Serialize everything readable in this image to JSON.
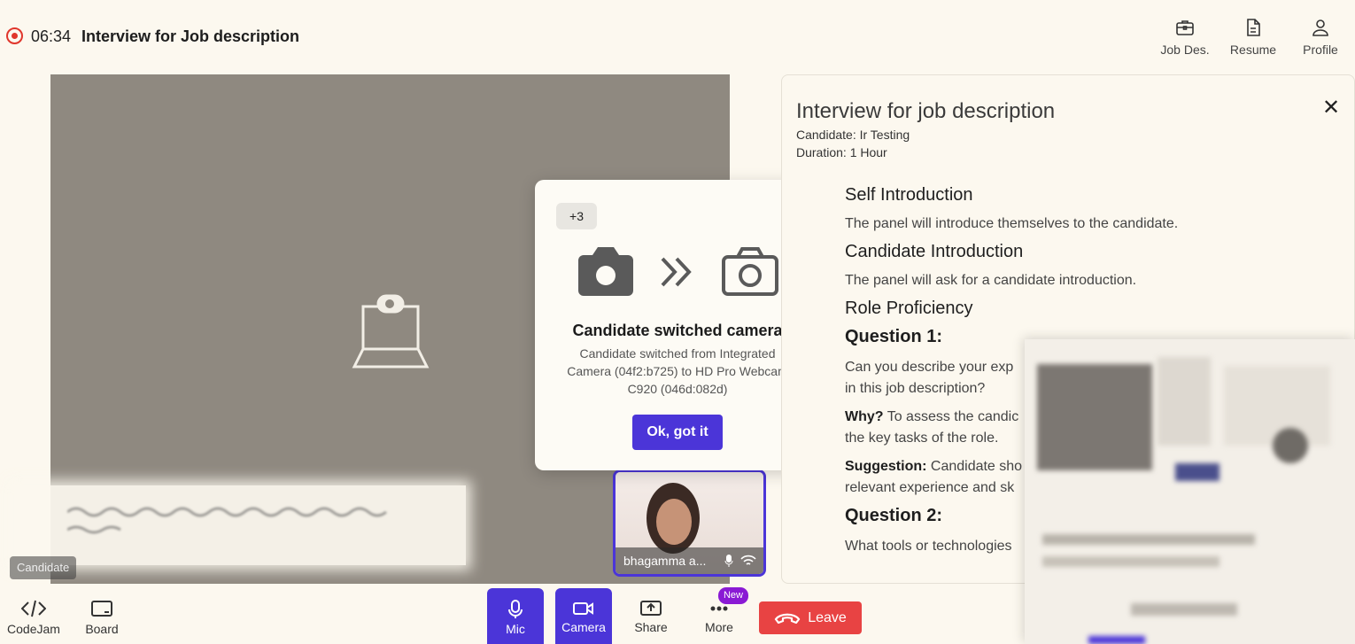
{
  "header": {
    "timer": "06:34",
    "title": "Interview for Job description",
    "actions": [
      {
        "label": "Job Des.",
        "icon": "briefcase-icon"
      },
      {
        "label": "Resume",
        "icon": "document-icon"
      },
      {
        "label": "Profile",
        "icon": "user-icon"
      }
    ]
  },
  "video": {
    "candidate_label": "Candidate",
    "self_name": "bhagamma a..."
  },
  "modal": {
    "badge": "+3",
    "title": "Candidate switched camera",
    "message": "Candidate switched from Integrated Camera (04f2:b725) to HD Pro Webcam C920 (046d:082d)",
    "button": "Ok, got it"
  },
  "panel": {
    "title": "Interview for job description",
    "candidate": "Candidate: Ir Testing",
    "duration": "Duration: 1 Hour",
    "close": "✕",
    "sections": {
      "s1_title": "Self Introduction",
      "s1_text": "The panel will introduce themselves to the candidate.",
      "s2_title": "Candidate Introduction",
      "s2_text": "The panel will ask for a candidate introduction.",
      "s3_title": "Role Proficiency",
      "q1_title": "Question 1:",
      "q1_text_l1": "Can you describe your exp",
      "q1_text_l2": "in this job description?",
      "why_label": "Why?",
      "why_text_l1": " To assess the candic",
      "why_text_l2": "the key tasks of the role.",
      "sugg_label": "Suggestion:",
      "sugg_text_l1": " Candidate sho",
      "sugg_text_l2": "relevant experience and sk",
      "q2_title": "Question 2:",
      "q2_text": "What tools or technologies"
    }
  },
  "bottom": {
    "codejam": "CodeJam",
    "board": "Board",
    "mic": "Mic",
    "camera": "Camera",
    "share": "Share",
    "more": "More",
    "new_badge": "New",
    "leave": "Leave"
  },
  "colors": {
    "accent": "#4b35d8",
    "leave": "#e84343",
    "background": "#fcf8ef",
    "new_badge": "#8a1ad4"
  }
}
